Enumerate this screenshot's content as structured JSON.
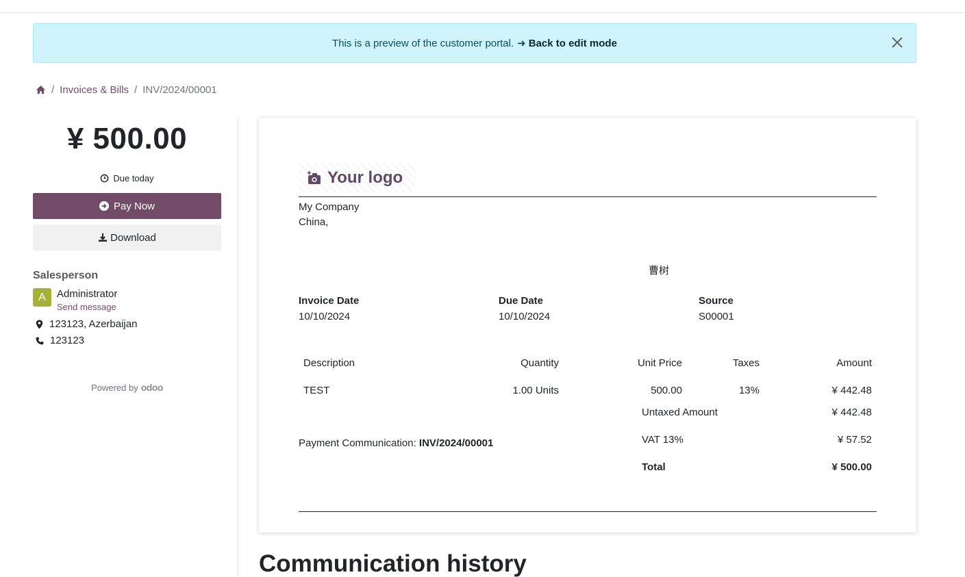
{
  "alert": {
    "message": "This is a preview of the customer portal.",
    "link_label": "Back to edit mode"
  },
  "breadcrumb": {
    "items": [
      "Invoices & Bills",
      "INV/2024/00001"
    ]
  },
  "sidebar": {
    "amount": "¥ 500.00",
    "due": "Due today",
    "pay_label": "Pay Now",
    "download_label": "Download",
    "salesperson_title": "Salesperson",
    "avatar_letter": "A",
    "salesperson_name": "Administrator",
    "send_message": "Send message",
    "address": "123123, Azerbaijan",
    "phone": "123123",
    "powered_by": "Powered by",
    "brand": "odoo"
  },
  "document": {
    "logo_text": "Your logo",
    "company_name": "My Company",
    "company_country": "China,",
    "partner": "曹树",
    "invoice_date_label": "Invoice Date",
    "invoice_date": "10/10/2024",
    "due_date_label": "Due Date",
    "due_date": "10/10/2024",
    "source_label": "Source",
    "source": "S00001",
    "columns": {
      "description": "Description",
      "quantity": "Quantity",
      "unit_price": "Unit Price",
      "taxes": "Taxes",
      "amount": "Amount"
    },
    "lines": [
      {
        "description": "TEST",
        "quantity": "1.00 Units",
        "unit_price": "500.00",
        "taxes": "13%",
        "amount": "¥ 442.48"
      }
    ],
    "untaxed_label": "Untaxed Amount",
    "untaxed_value": "¥ 442.48",
    "vat_label": "VAT 13%",
    "vat_value": "¥ 57.52",
    "total_label": "Total",
    "total_value": "¥ 500.00",
    "payment_comm_label": "Payment Communication:",
    "payment_comm_value": "INV/2024/00001"
  },
  "communication": {
    "title": "Communication history"
  },
  "colors": {
    "brand": "#714b67",
    "alert_bg": "#cff4fc",
    "avatar": "#a3b137"
  }
}
